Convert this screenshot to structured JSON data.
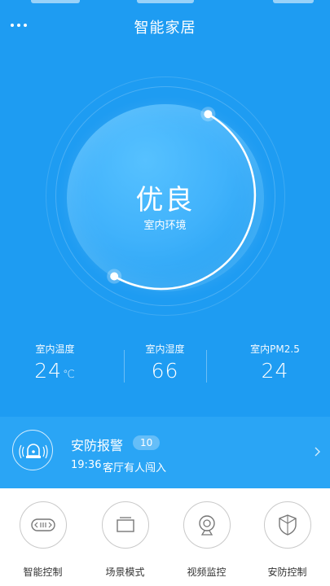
{
  "header": {
    "title": "智能家居",
    "more_icon": "more-dots-icon"
  },
  "gauge": {
    "quality": "优良",
    "subtitle": "室内环境"
  },
  "stats": [
    {
      "label": "室内温度",
      "value": "24",
      "unit": "℃"
    },
    {
      "label": "室内湿度",
      "value": "66",
      "unit": ""
    },
    {
      "label": "室内PM2.5",
      "value": "24",
      "unit": ""
    }
  ],
  "alarm": {
    "title": "安防报警",
    "count": "10",
    "time": "19:36",
    "message": "客厅有人闯入",
    "icon": "alarm-siren-icon"
  },
  "bottom_nav": [
    {
      "label": "智能控制",
      "icon": "remote-control-icon"
    },
    {
      "label": "场景模式",
      "icon": "scene-icon"
    },
    {
      "label": "视频监控",
      "icon": "camera-icon"
    },
    {
      "label": "安防控制",
      "icon": "shield-icon"
    }
  ],
  "colors": {
    "primary": "#1e9cf2",
    "alarm_bg": "#2aa5f5",
    "text_on_primary": "#ffffff"
  }
}
